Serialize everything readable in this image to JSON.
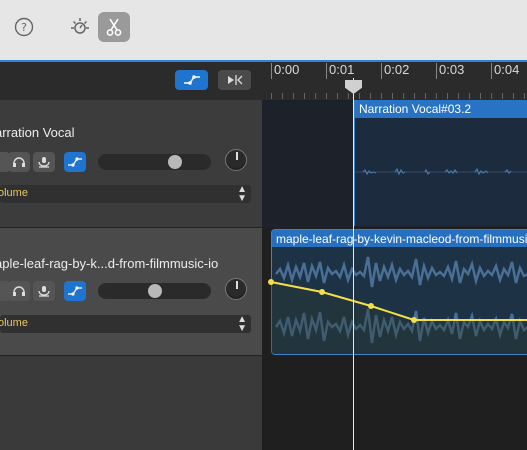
{
  "toolbar": {
    "help_icon": "question-circle-icon",
    "smart_controls_icon": "smart-controls-icon",
    "scissors_icon": "scissors-icon"
  },
  "track_header": {
    "automation_on_icon": "automation-curve-icon",
    "automation_off_icon": "automation-snap-icon"
  },
  "tracks": [
    {
      "name": "arration Vocal",
      "automation_param": "olume",
      "volume_fraction": 0.71
    },
    {
      "name": "aple-leaf-rag-by-k...d-from-filmmusic-io",
      "automation_param": "olume",
      "volume_fraction": 0.5
    }
  ],
  "ruler": {
    "labels": [
      "0:00",
      "0:01",
      "0:02",
      "0:03",
      "0:04"
    ]
  },
  "regions": {
    "narration": {
      "title": "Narration Vocal#03.2"
    },
    "music": {
      "title": "maple-leaf-rag-by-kevin-macleod-from-filmmusic"
    }
  },
  "colors": {
    "accent_blue": "#1f74cf",
    "automation_yellow": "#f2e04a",
    "region_blue": "#2873c4"
  }
}
